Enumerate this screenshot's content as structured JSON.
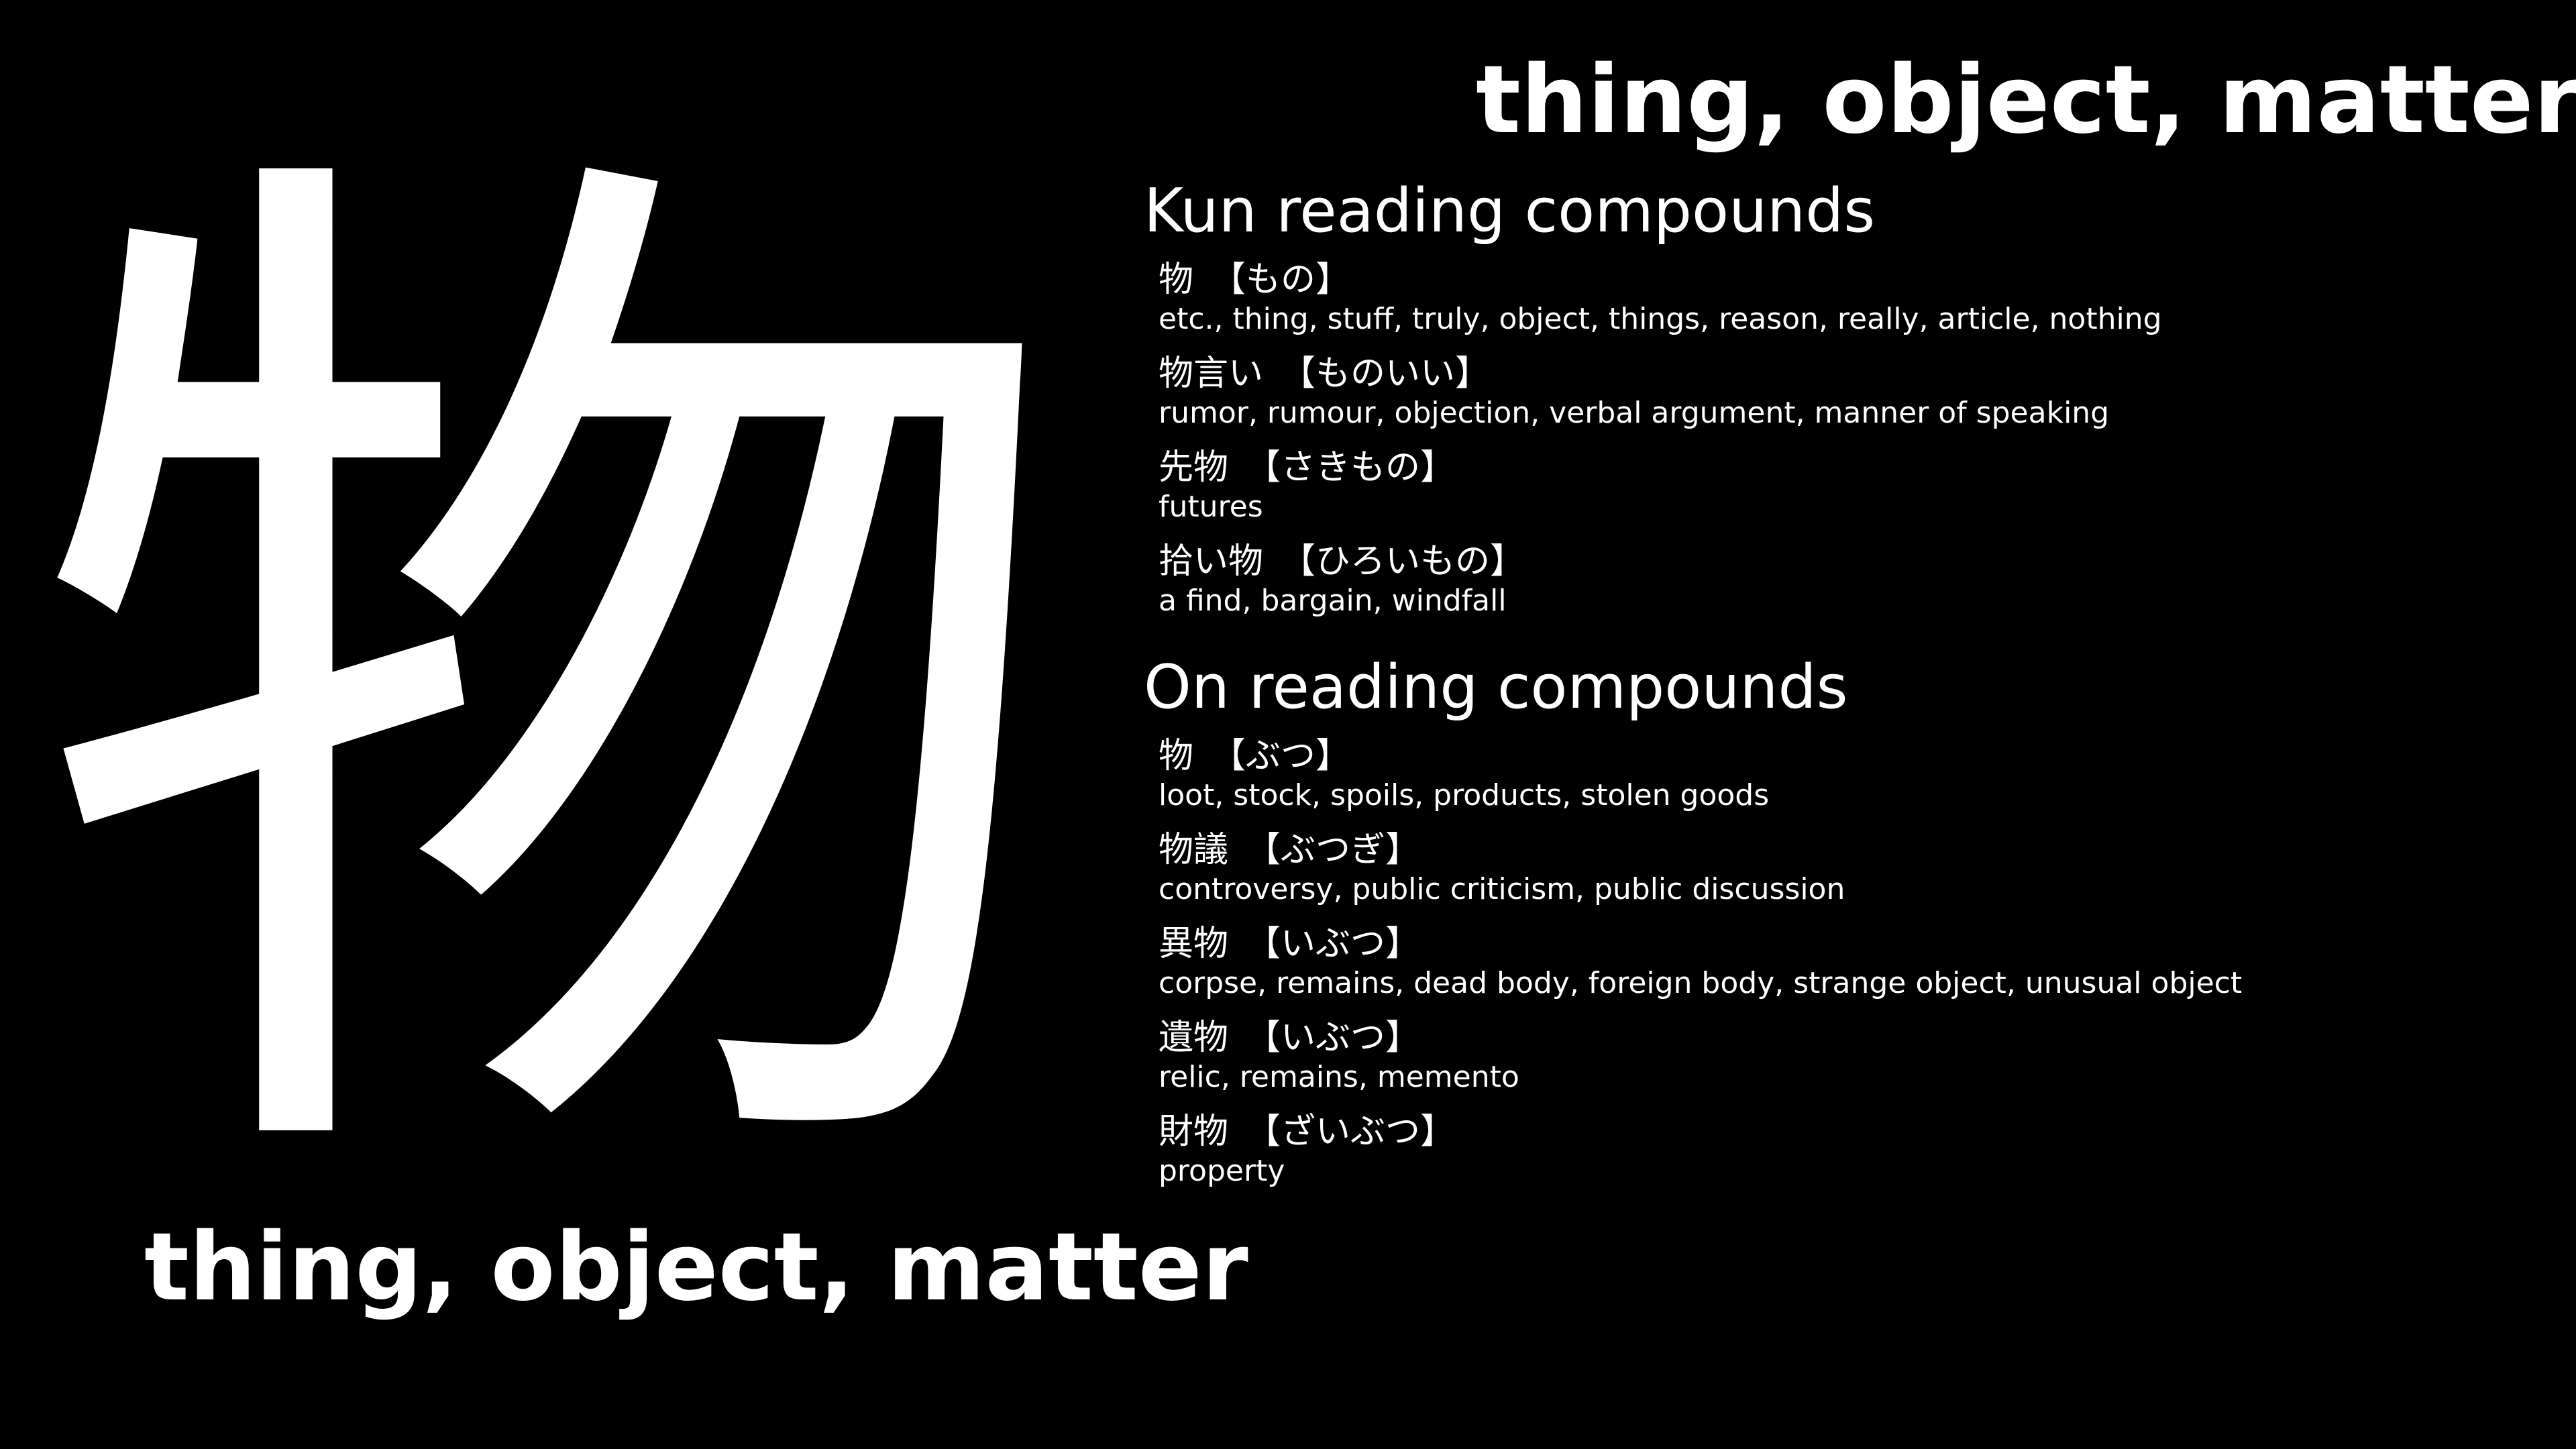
{
  "kanji": "物",
  "meaning": "thing, object, matter",
  "kun_section": {
    "title": "Kun reading compounds",
    "entries": [
      {
        "word": "物",
        "reading": "【もの】",
        "gloss": "etc., thing, stuff, truly, object, things, reason, really, article, nothing"
      },
      {
        "word": "物言い",
        "reading": "【ものいい】",
        "gloss": "rumor, rumour, objection, verbal argument, manner of speaking"
      },
      {
        "word": "先物",
        "reading": "【さきもの】",
        "gloss": "futures"
      },
      {
        "word": "拾い物",
        "reading": "【ひろいもの】",
        "gloss": "a find, bargain, windfall"
      }
    ]
  },
  "on_section": {
    "title": "On reading compounds",
    "entries": [
      {
        "word": "物",
        "reading": "【ぶつ】",
        "gloss": "loot, stock, spoils, products, stolen goods"
      },
      {
        "word": "物議",
        "reading": "【ぶつぎ】",
        "gloss": "controversy, public criticism, public discussion"
      },
      {
        "word": "異物",
        "reading": "【いぶつ】",
        "gloss": "corpse, remains, dead body, foreign body, strange object, unusual object"
      },
      {
        "word": "遺物",
        "reading": "【いぶつ】",
        "gloss": "relic, remains, memento"
      },
      {
        "word": "財物",
        "reading": "【ざいぶつ】",
        "gloss": "property"
      }
    ]
  },
  "colors": {
    "background": "#000000",
    "text": "#ffffff"
  }
}
